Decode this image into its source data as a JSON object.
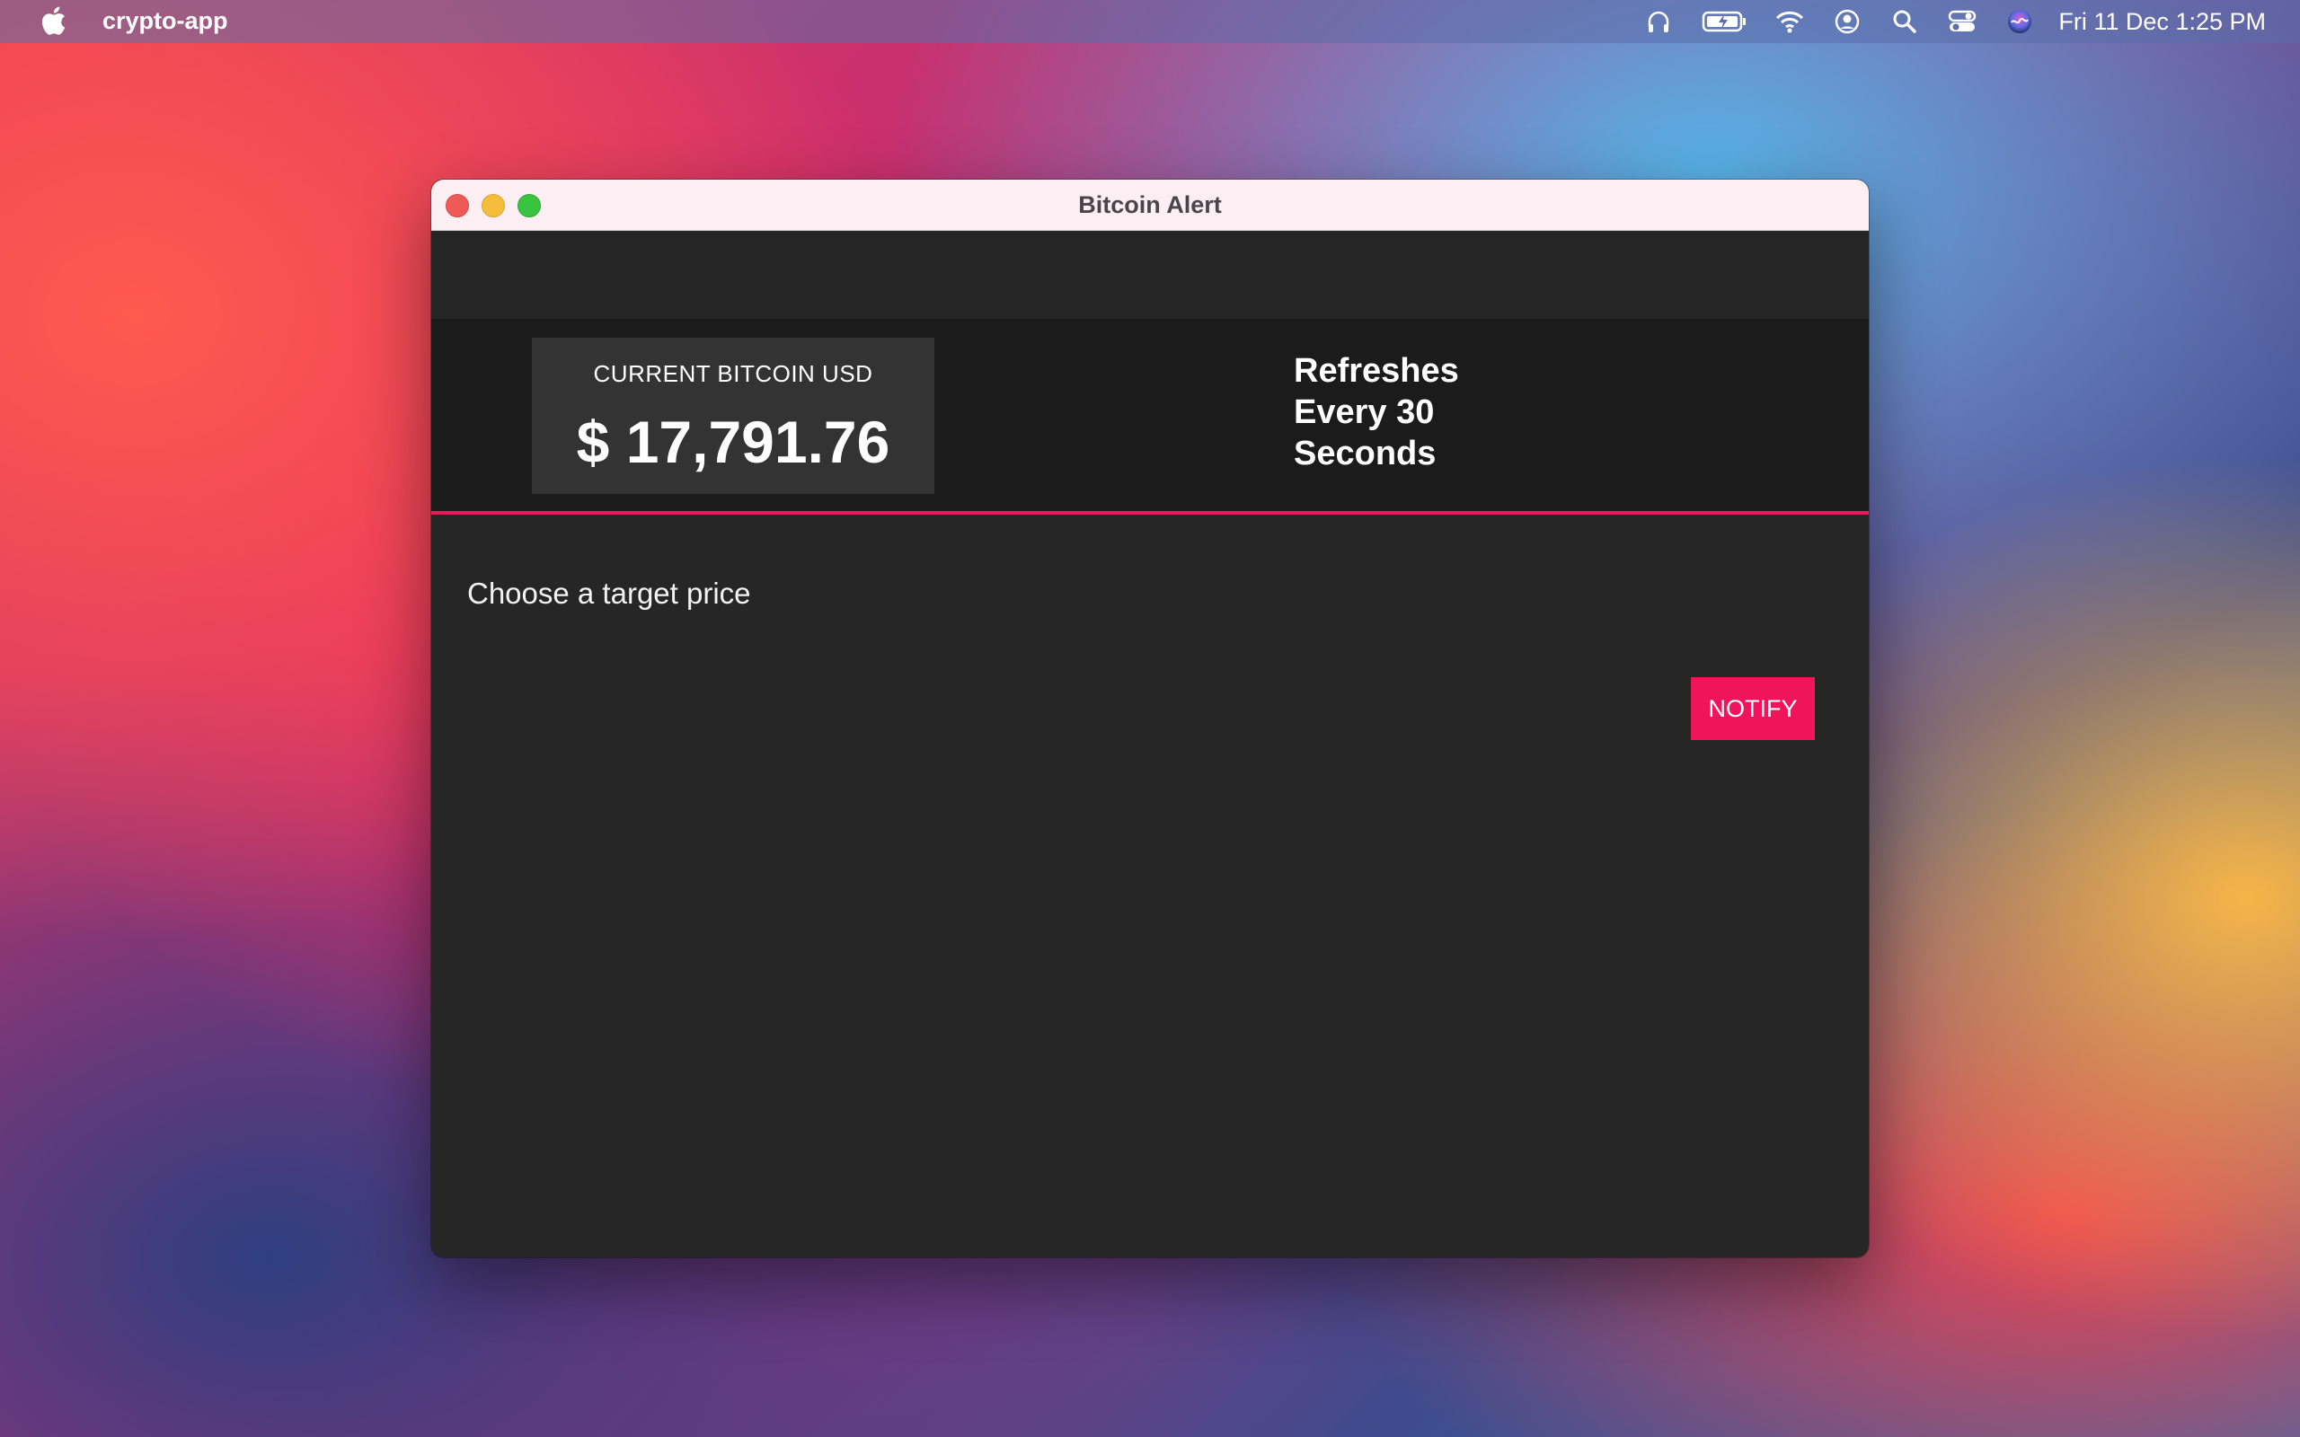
{
  "menubar": {
    "app_name": "crypto-app",
    "icons": [
      "apple-icon",
      "headphones-icon",
      "battery-charging-icon",
      "wifi-icon",
      "user-icon",
      "search-icon",
      "control-center-icon",
      "siri-icon"
    ],
    "clock": "Fri 11 Dec  1:25 PM"
  },
  "window": {
    "title": "Bitcoin Alert",
    "price_card": {
      "label": "CURRENT BITCOIN USD",
      "value": "$ 17,791.76"
    },
    "refresh": {
      "line1": "Refreshes",
      "line2": "Every 30",
      "line3": "Seconds"
    },
    "target_prompt": "Choose a target price",
    "notify_label": "NOTIFY"
  },
  "colors": {
    "accent": "#f0155a",
    "window_bg": "#262626",
    "banner_bg": "#1b1b1b",
    "card_bg": "#333333"
  }
}
